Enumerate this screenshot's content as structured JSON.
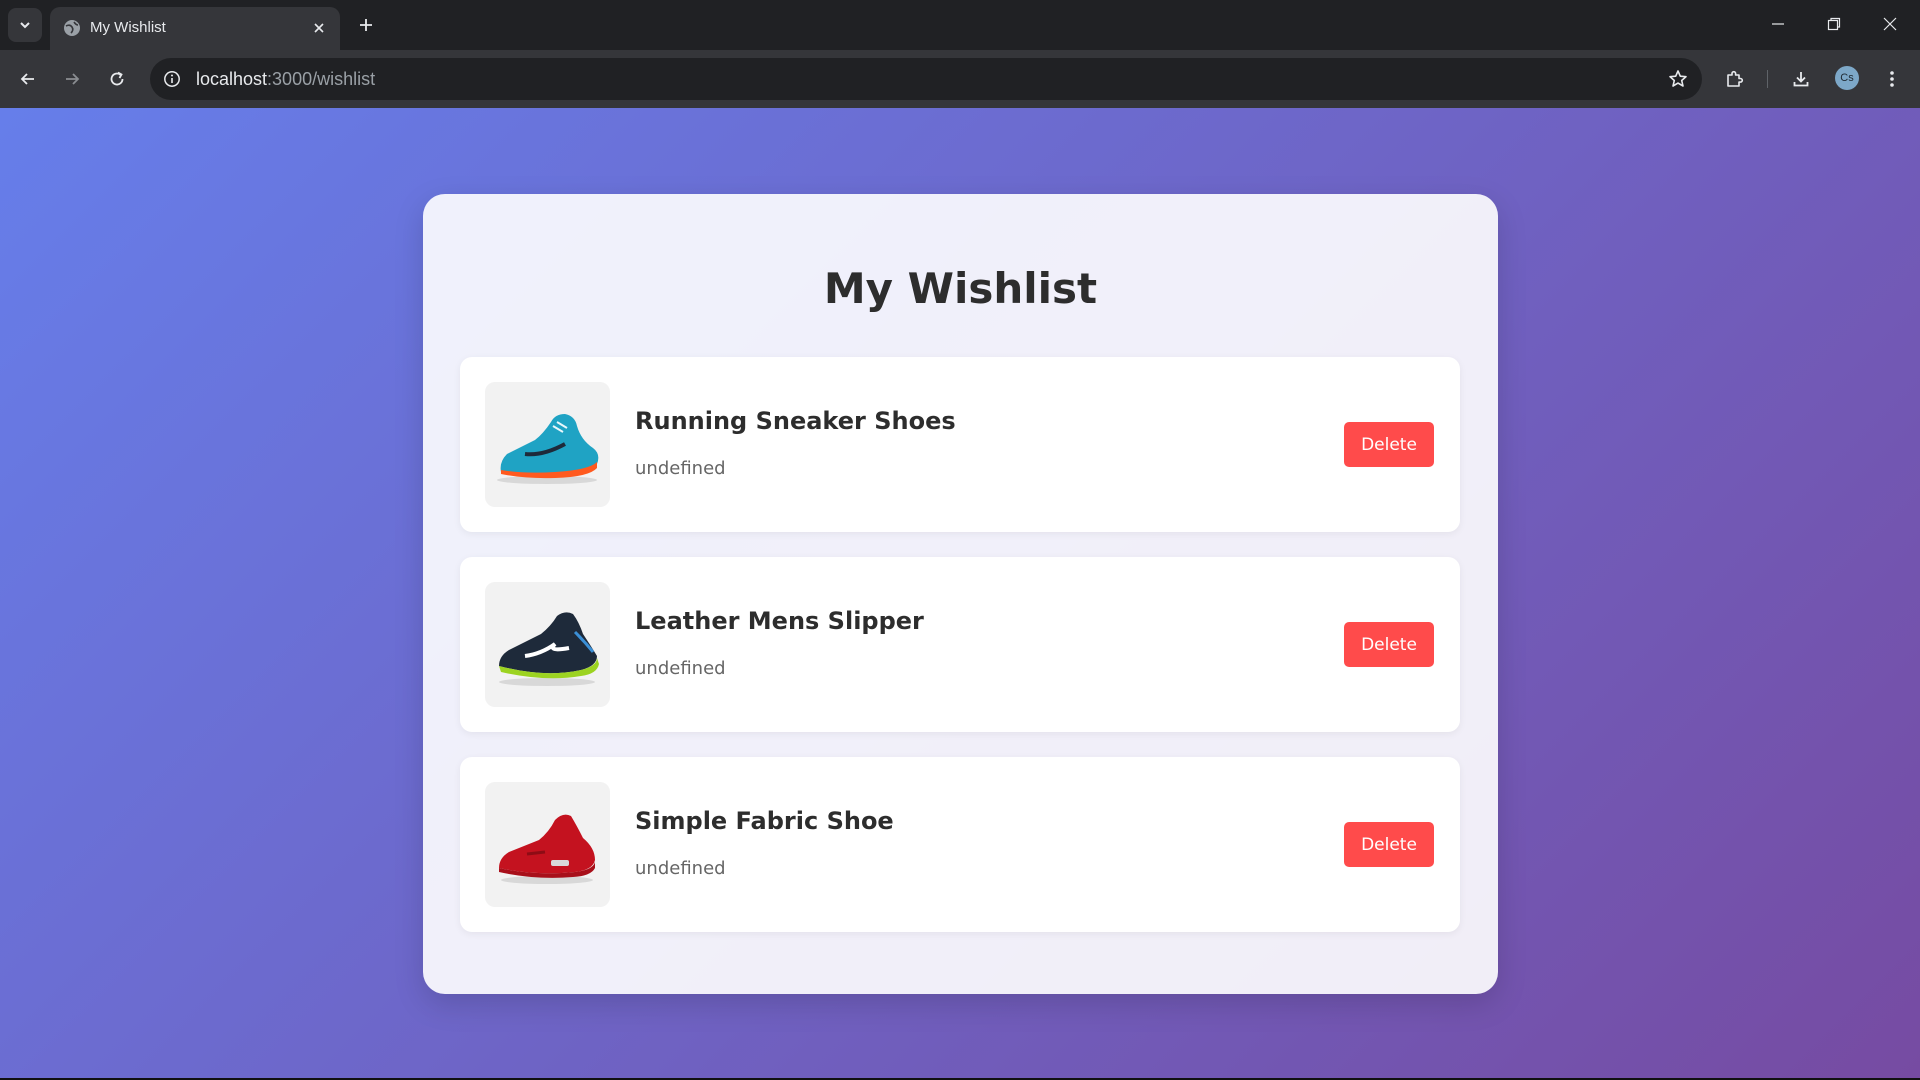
{
  "browser": {
    "tab_title": "My Wishlist",
    "url_host": "localhost",
    "url_path": ":3000/wishlist",
    "profile_initials": "Cs"
  },
  "page": {
    "title": "My Wishlist",
    "items": [
      {
        "name": "Running Sneaker Shoes",
        "price": "undefined",
        "delete_label": "Delete",
        "shoe_color": "#1fa3c4",
        "sole_color": "#ff5a1f"
      },
      {
        "name": "Leather Mens Slipper",
        "price": "undefined",
        "delete_label": "Delete",
        "shoe_color": "#1e2a3a",
        "sole_color": "#9cd321"
      },
      {
        "name": "Simple Fabric Shoe",
        "price": "undefined",
        "delete_label": "Delete",
        "shoe_color": "#c4121f",
        "sole_color": "#a80f1a"
      }
    ]
  },
  "colors": {
    "gradient_start": "#667eea",
    "gradient_end": "#764ba2",
    "delete_button": "#ff4b4b"
  }
}
